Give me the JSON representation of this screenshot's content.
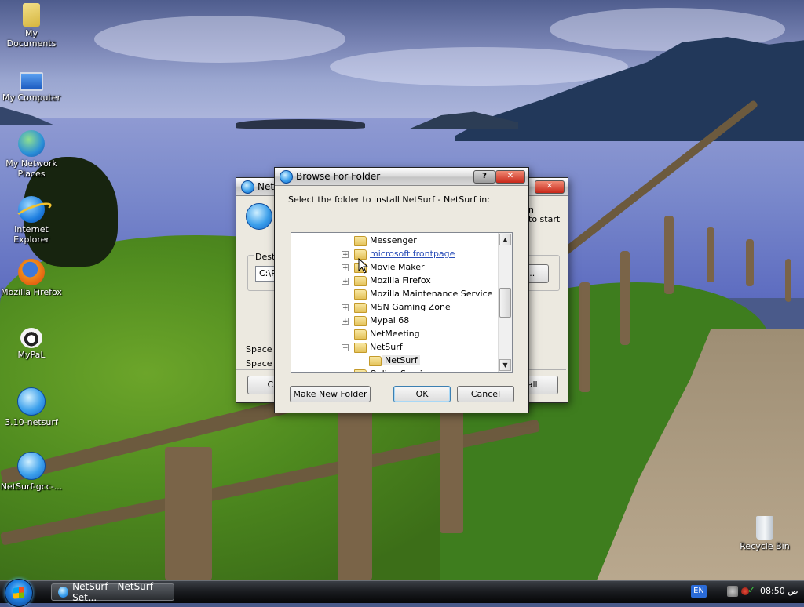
{
  "desktop": {
    "icons": [
      {
        "label": "My Documents",
        "icon": "documents-folder-icon"
      },
      {
        "label": "My Computer",
        "icon": "computer-icon"
      },
      {
        "label": "My Network Places",
        "icon": "network-icon"
      },
      {
        "label": "Internet Explorer",
        "icon": "internet-explorer-icon"
      },
      {
        "label": "Mozilla Firefox",
        "icon": "firefox-icon"
      },
      {
        "label": "MyPaL",
        "icon": "mypal-icon"
      },
      {
        "label": "3.10-netsurf",
        "icon": "netsurf-globe-icon"
      },
      {
        "label": "NetSurf-gcc-...",
        "icon": "netsurf-globe-icon"
      },
      {
        "label": "Recycle Bin",
        "icon": "recycle-bin-icon"
      }
    ]
  },
  "installer": {
    "title": "NetSu",
    "dest_label": "Desti",
    "dest_value": "C:\\P",
    "right_text_1": "n",
    "right_text_2": "to start",
    "browse_label": "...",
    "space_required": "Space r",
    "space_available": "Space a",
    "cancel_label": "Car",
    "install_label": "tall"
  },
  "dialog": {
    "title": "Browse For Folder",
    "help_label": "?",
    "close_label": "✕",
    "instruction": "Select the folder to install NetSurf - NetSurf in:",
    "tree": [
      {
        "label": "Messenger",
        "expander": "",
        "level": 0,
        "style": "normal"
      },
      {
        "label": "microsoft frontpage",
        "expander": "+",
        "level": 0,
        "style": "link"
      },
      {
        "label": "Movie Maker",
        "expander": "+",
        "level": 0,
        "style": "normal"
      },
      {
        "label": "Mozilla Firefox",
        "expander": "+",
        "level": 0,
        "style": "normal"
      },
      {
        "label": "Mozilla Maintenance Service",
        "expander": "",
        "level": 0,
        "style": "normal"
      },
      {
        "label": "MSN Gaming Zone",
        "expander": "+",
        "level": 0,
        "style": "normal"
      },
      {
        "label": "Mypal 68",
        "expander": "+",
        "level": 0,
        "style": "normal"
      },
      {
        "label": "NetMeeting",
        "expander": "",
        "level": 0,
        "style": "normal"
      },
      {
        "label": "NetSurf",
        "expander": "−",
        "level": 0,
        "style": "normal"
      },
      {
        "label": "NetSurf",
        "expander": "",
        "level": 1,
        "style": "selected"
      },
      {
        "label": "Online Services",
        "expander": "",
        "level": 0,
        "style": "normal"
      }
    ],
    "buttons": {
      "new_folder": "Make New Folder",
      "ok": "OK",
      "cancel": "Cancel"
    }
  },
  "taskbar": {
    "task_label": "NetSurf - NetSurf Set...",
    "language": "EN",
    "clock": "08:50 ص"
  },
  "colors": {
    "accent": "#3c7fb1",
    "link": "#2a4eb8",
    "taskbar": "#1b1d21"
  }
}
